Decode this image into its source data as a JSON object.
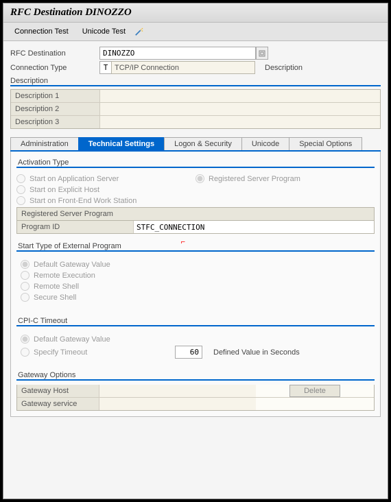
{
  "title": "RFC Destination DINOZZO",
  "toolbar": {
    "connection_test": "Connection Test",
    "unicode_test": "Unicode Test"
  },
  "header": {
    "rfc_destination_label": "RFC Destination",
    "rfc_destination": "DINOZZO",
    "connection_type_label": "Connection Type",
    "connection_type_code": "T",
    "connection_type_text": "TCP/IP Connection",
    "description_label": "Description"
  },
  "desc": {
    "group": "Description",
    "row1": "Description 1",
    "row2": "Description 2",
    "row3": "Description 3",
    "val1": "",
    "val2": "",
    "val3": ""
  },
  "tabs": {
    "admin": "Administration",
    "tech": "Technical Settings",
    "logon": "Logon & Security",
    "unicode": "Unicode",
    "special": "Special Options"
  },
  "activation": {
    "title": "Activation Type",
    "opt1": "Start on Application Server",
    "opt2": "Start on Explicit Host",
    "opt3": "Start on Front-End Work Station",
    "opt4": "Registered Server Program"
  },
  "reg_prog": {
    "title": "Registered Server Program",
    "program_id_label": "Program ID",
    "program_id": "STFC_CONNECTION"
  },
  "start_type": {
    "title": "Start Type of External Program",
    "opt1": "Default Gateway Value",
    "opt2": "Remote Execution",
    "opt3": "Remote Shell",
    "opt4": "Secure Shell"
  },
  "cpic": {
    "title": "CPI-C Timeout",
    "opt1": "Default Gateway Value",
    "opt2": "Specify Timeout",
    "timeout_value": "60",
    "timeout_label": "Defined Value in Seconds"
  },
  "gateway": {
    "title": "Gateway Options",
    "host_label": "Gateway Host",
    "service_label": "Gateway service",
    "host": "",
    "service": "",
    "delete": "Delete"
  }
}
